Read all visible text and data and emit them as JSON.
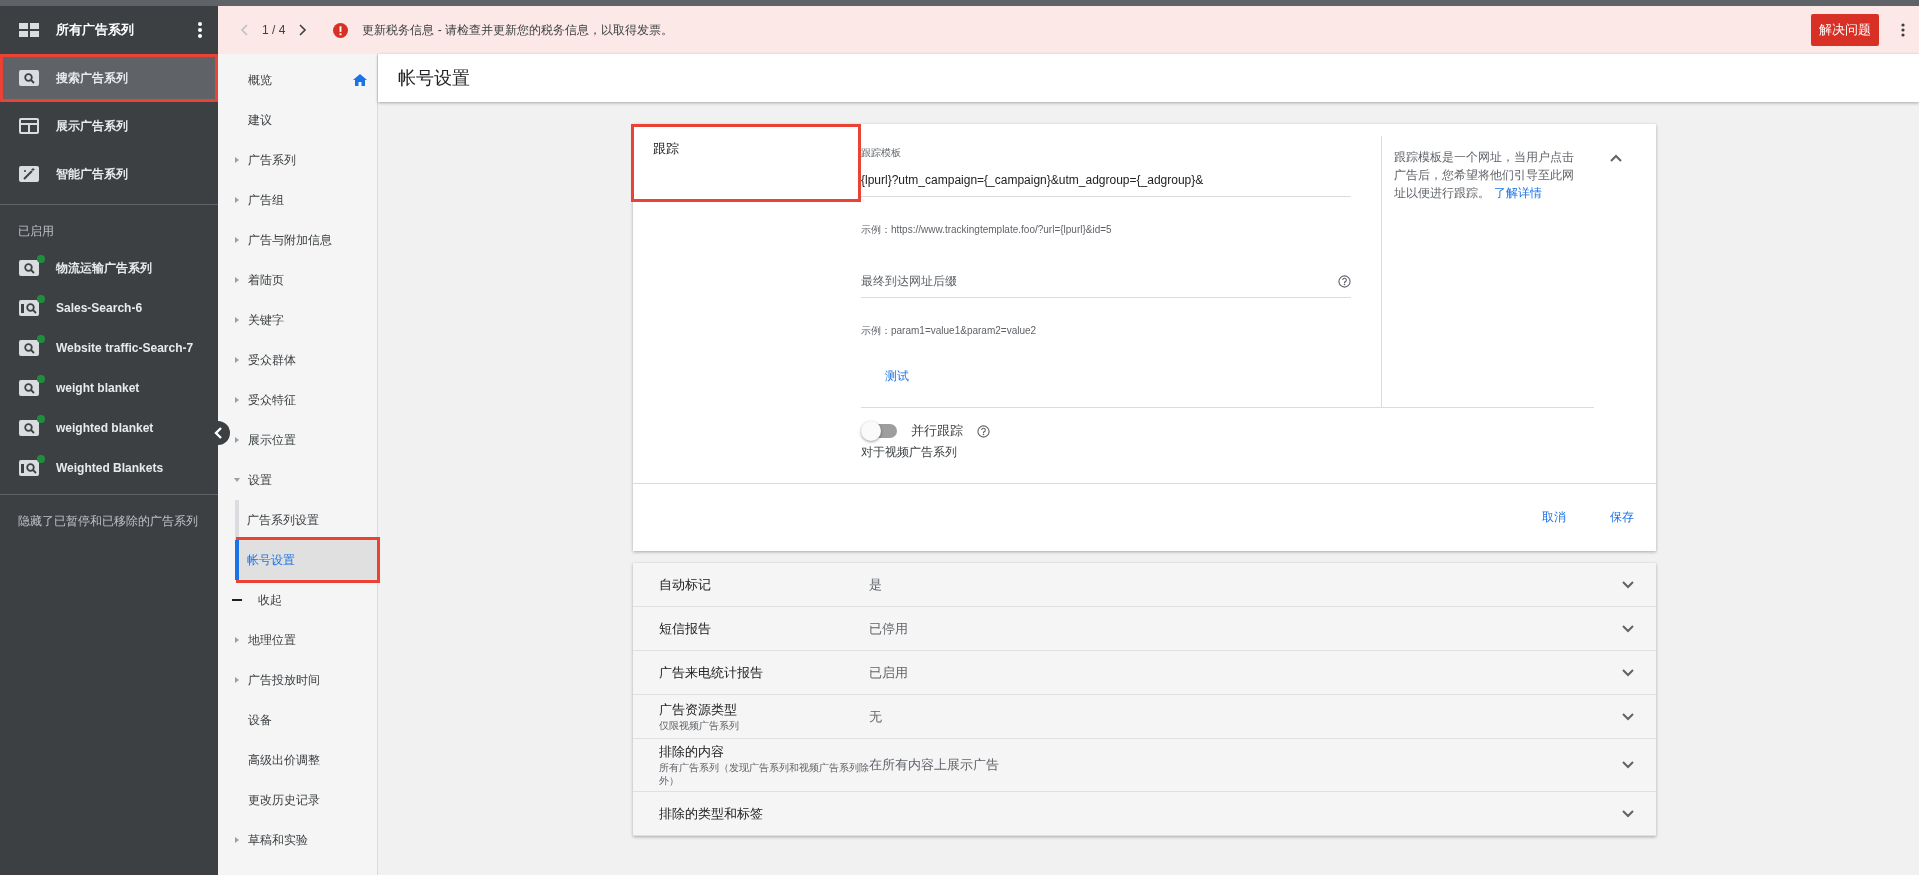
{
  "sidebar": {
    "header": {
      "title": "所有广告系列"
    },
    "types": [
      {
        "label": "搜索广告系列",
        "kind": "search",
        "selected": true,
        "highlighted": true
      },
      {
        "label": "展示广告系列",
        "kind": "display",
        "selected": false,
        "highlighted": false
      },
      {
        "label": "智能广告系列",
        "kind": "smart",
        "selected": false,
        "highlighted": false
      }
    ],
    "section_title": "已启用",
    "campaigns": [
      {
        "label": "物流运输广告系列",
        "kind": "search",
        "color": "#1e8e3e",
        "selected": false
      },
      {
        "label": "Sales-Search-6",
        "kind": "network",
        "color": "#1e8e3e",
        "selected": false
      },
      {
        "label": "Website traffic-Search-7",
        "kind": "search",
        "color": "#1e8e3e",
        "selected": false
      },
      {
        "label": "weight blanket",
        "kind": "search",
        "color": "#1e8e3e",
        "selected": false
      },
      {
        "label": "weighted blanket",
        "kind": "search",
        "color": "#1e8e3e",
        "selected": false
      },
      {
        "label": "Weighted Blankets",
        "kind": "network",
        "color": "#1e8e3e",
        "selected": false
      }
    ],
    "footer_note": "隐藏了已暂停和已移除的广告系列"
  },
  "alert": {
    "pager": "1 / 4",
    "message": "更新税务信息 - 请检查并更新您的税务信息，以取得发票。",
    "button": "解决问题"
  },
  "nav": [
    {
      "label": "概览",
      "kind": "home",
      "selected": false,
      "highlighted": false
    },
    {
      "label": "建议",
      "kind": "leaf",
      "selected": false,
      "highlighted": false
    },
    {
      "label": "广告系列",
      "kind": "group",
      "expanded": false,
      "selected": false,
      "highlighted": false
    },
    {
      "label": "广告组",
      "kind": "group",
      "expanded": false,
      "selected": false,
      "highlighted": false
    },
    {
      "label": "广告与附加信息",
      "kind": "group",
      "expanded": false,
      "selected": false,
      "highlighted": false
    },
    {
      "label": "着陆页",
      "kind": "group",
      "expanded": false,
      "selected": false,
      "highlighted": false
    },
    {
      "label": "关键字",
      "kind": "group",
      "expanded": false,
      "selected": false,
      "highlighted": false
    },
    {
      "label": "受众群体",
      "kind": "group",
      "expanded": false,
      "selected": false,
      "highlighted": false
    },
    {
      "label": "受众特征",
      "kind": "group",
      "expanded": false,
      "selected": false,
      "highlighted": false
    },
    {
      "label": "展示位置",
      "kind": "group",
      "expanded": false,
      "selected": false,
      "highlighted": false
    },
    {
      "label": "设置",
      "kind": "group",
      "expanded": true,
      "selected": false,
      "highlighted": false,
      "children": [
        {
          "label": "广告系列设置",
          "kind": "leaf",
          "selected": false,
          "highlighted": false
        },
        {
          "label": "帐号设置",
          "kind": "leaf",
          "selected": true,
          "highlighted": true
        }
      ]
    },
    {
      "label": "收起",
      "kind": "collapse",
      "selected": false,
      "highlighted": false
    },
    {
      "label": "地理位置",
      "kind": "group",
      "expanded": false,
      "selected": false,
      "highlighted": false
    },
    {
      "label": "广告投放时间",
      "kind": "group",
      "expanded": false,
      "selected": false,
      "highlighted": false
    },
    {
      "label": "设备",
      "kind": "leaf",
      "selected": false,
      "highlighted": false
    },
    {
      "label": "高级出价调整",
      "kind": "leaf",
      "selected": false,
      "highlighted": false
    },
    {
      "label": "更改历史记录",
      "kind": "leaf",
      "selected": false,
      "highlighted": false
    },
    {
      "label": "草稿和实验",
      "kind": "group",
      "expanded": false,
      "selected": false,
      "highlighted": false
    }
  ],
  "page_title": "帐号设置",
  "tracking_card": {
    "title": "跟踪",
    "highlighted": true,
    "expanded": true,
    "fields": [
      {
        "label": "跟踪模板",
        "value": "{lpurl}?utm_campaign={_campaign}&utm_adgroup={_adgroup}&",
        "help": false,
        "example": "示例：https://www.trackingtemplate.foo/?url={lpurl}&id=5"
      },
      {
        "placeholder": "最终到达网址后缀",
        "help": true,
        "example": "示例：param1=value1&param2=value2"
      }
    ],
    "test_link": "测试",
    "parallel_tracking": {
      "label": "并行跟踪",
      "on": false,
      "note": "对于视频广告系列"
    },
    "help_text": "跟踪模板是一个网址，当用户点击广告后，您希望将他们引导至此网址以便进行跟踪。",
    "help_link": "了解详情",
    "actions": [
      "取消",
      "保存"
    ]
  },
  "settings": [
    {
      "label": "自动标记",
      "value": "是",
      "expanded": false
    },
    {
      "label": "短信报告",
      "value": "已停用",
      "expanded": false
    },
    {
      "label": "广告来电统计报告",
      "value": "已启用",
      "expanded": false
    },
    {
      "label": "广告资源类型",
      "sublabel": "仅限视频广告系列",
      "value": "无",
      "expanded": false
    },
    {
      "label": "排除的内容",
      "sublabel": "所有广告系列（发现广告系列和视频广告系列除外）",
      "value": "在所有内容上展示广告",
      "expanded": false
    },
    {
      "label": "排除的类型和标签",
      "expanded": false
    }
  ]
}
